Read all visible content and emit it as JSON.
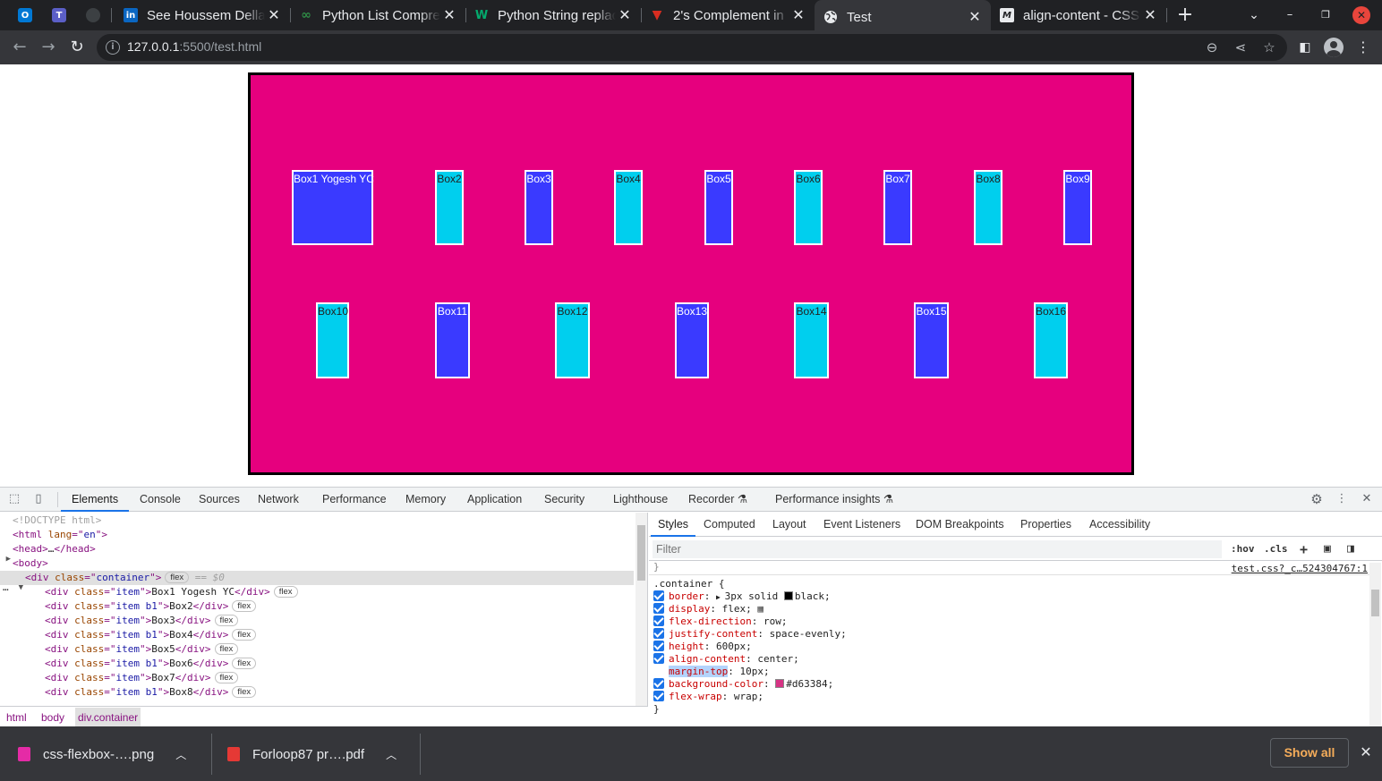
{
  "browser": {
    "pinned_tabs": [
      {
        "icon": "outlook-icon",
        "label": "O",
        "color": "#0078d4"
      },
      {
        "icon": "teams-icon",
        "label": "T",
        "color": "#5b5fc7"
      },
      {
        "icon": "github-icon",
        "label": "",
        "color": "#3c4043"
      }
    ],
    "tabs": [
      {
        "title": "See Houssem Dellai",
        "icon": "linkedin-icon",
        "icon_text": "in",
        "icon_color": "#0a66c2"
      },
      {
        "title": "Python List Comprehension",
        "icon": "geeksforgeeks-icon",
        "icon_text": "∞",
        "icon_color": "#2f8d46"
      },
      {
        "title": "Python String replace",
        "icon": "w3schools-icon",
        "icon_text": "W",
        "icon_color": "#04aa6d"
      },
      {
        "title": "2's Complement in",
        "icon": "tutorialspoint-icon",
        "icon_text": "▼",
        "icon_color": "#d92d20"
      },
      {
        "title": "Test",
        "icon": "globe-icon",
        "icon_text": "🌐",
        "icon_color": "#e8eaed",
        "active": true
      },
      {
        "title": "align-content - CSS",
        "icon": "mdn-icon",
        "icon_text": "M",
        "icon_color": "#e8eaed"
      }
    ],
    "url_host": "127.0.0.1",
    "url_path": ":5500/test.html"
  },
  "page": {
    "container_color": "#e6007e",
    "box_colors": {
      "blue": "#3a3aff",
      "cyan": "#00cfee"
    },
    "boxes": [
      {
        "label": "Box1 Yogesh YC",
        "color": "blue"
      },
      {
        "label": "Box2",
        "color": "cyan"
      },
      {
        "label": "Box3",
        "color": "blue"
      },
      {
        "label": "Box4",
        "color": "cyan"
      },
      {
        "label": "Box5",
        "color": "blue"
      },
      {
        "label": "Box6",
        "color": "cyan"
      },
      {
        "label": "Box7",
        "color": "blue"
      },
      {
        "label": "Box8",
        "color": "cyan"
      },
      {
        "label": "Box9",
        "color": "blue"
      },
      {
        "label": "Box10",
        "color": "cyan"
      },
      {
        "label": "Box11",
        "color": "blue"
      },
      {
        "label": "Box12",
        "color": "cyan"
      },
      {
        "label": "Box13",
        "color": "blue"
      },
      {
        "label": "Box14",
        "color": "cyan"
      },
      {
        "label": "Box15",
        "color": "blue"
      },
      {
        "label": "Box16",
        "color": "cyan"
      }
    ]
  },
  "devtools": {
    "tabs": [
      "Elements",
      "Console",
      "Sources",
      "Network",
      "Performance",
      "Memory",
      "Application",
      "Security",
      "Lighthouse",
      "Recorder ⚗",
      "Performance insights ⚗"
    ],
    "active_tab": "Elements",
    "dom_lines": [
      {
        "indent": 1,
        "arrow": "",
        "parts": [
          {
            "t": "<!DOCTYPE html>",
            "c": "grey"
          }
        ]
      },
      {
        "indent": 1,
        "arrow": "",
        "parts": [
          {
            "t": "<html ",
            "c": "tag"
          },
          {
            "t": "lang",
            "c": "attr"
          },
          {
            "t": "=\"",
            "c": "tag"
          },
          {
            "t": "en",
            "c": "val"
          },
          {
            "t": "\">",
            "c": "tag"
          }
        ]
      },
      {
        "indent": 1,
        "arrow": "▶",
        "parts": [
          {
            "t": "<head>",
            "c": "tag"
          },
          {
            "t": "…",
            "c": "txt"
          },
          {
            "t": "</head>",
            "c": "tag"
          }
        ]
      },
      {
        "indent": 1,
        "arrow": "▼",
        "parts": [
          {
            "t": "<body>",
            "c": "tag"
          }
        ]
      },
      {
        "indent": 2,
        "arrow": "▼",
        "sel": true,
        "pill": "flex",
        "suffix": " == $0",
        "parts": [
          {
            "t": "<div ",
            "c": "tag"
          },
          {
            "t": "class",
            "c": "attr"
          },
          {
            "t": "=\"",
            "c": "tag"
          },
          {
            "t": "container",
            "c": "val"
          },
          {
            "t": "\">",
            "c": "tag"
          }
        ]
      },
      {
        "indent": 3,
        "arrow": "",
        "pill": "flex",
        "parts": [
          {
            "t": "<div ",
            "c": "tag"
          },
          {
            "t": "class",
            "c": "attr"
          },
          {
            "t": "=\"",
            "c": "tag"
          },
          {
            "t": "item",
            "c": "val"
          },
          {
            "t": "\">",
            "c": "tag"
          },
          {
            "t": "Box1 Yogesh YC",
            "c": "txt"
          },
          {
            "t": "</div>",
            "c": "tag"
          }
        ]
      },
      {
        "indent": 3,
        "arrow": "",
        "pill": "flex",
        "parts": [
          {
            "t": "<div ",
            "c": "tag"
          },
          {
            "t": "class",
            "c": "attr"
          },
          {
            "t": "=\"",
            "c": "tag"
          },
          {
            "t": "item b1",
            "c": "val"
          },
          {
            "t": "\">",
            "c": "tag"
          },
          {
            "t": "Box2",
            "c": "txt"
          },
          {
            "t": "</div>",
            "c": "tag"
          }
        ]
      },
      {
        "indent": 3,
        "arrow": "",
        "pill": "flex",
        "parts": [
          {
            "t": "<div ",
            "c": "tag"
          },
          {
            "t": "class",
            "c": "attr"
          },
          {
            "t": "=\"",
            "c": "tag"
          },
          {
            "t": "item",
            "c": "val"
          },
          {
            "t": "\">",
            "c": "tag"
          },
          {
            "t": "Box3",
            "c": "txt"
          },
          {
            "t": "</div>",
            "c": "tag"
          }
        ]
      },
      {
        "indent": 3,
        "arrow": "",
        "pill": "flex",
        "parts": [
          {
            "t": "<div ",
            "c": "tag"
          },
          {
            "t": "class",
            "c": "attr"
          },
          {
            "t": "=\"",
            "c": "tag"
          },
          {
            "t": "item b1",
            "c": "val"
          },
          {
            "t": "\">",
            "c": "tag"
          },
          {
            "t": "Box4",
            "c": "txt"
          },
          {
            "t": "</div>",
            "c": "tag"
          }
        ]
      },
      {
        "indent": 3,
        "arrow": "",
        "pill": "flex",
        "parts": [
          {
            "t": "<div ",
            "c": "tag"
          },
          {
            "t": "class",
            "c": "attr"
          },
          {
            "t": "=\"",
            "c": "tag"
          },
          {
            "t": "item",
            "c": "val"
          },
          {
            "t": "\">",
            "c": "tag"
          },
          {
            "t": "Box5",
            "c": "txt"
          },
          {
            "t": "</div>",
            "c": "tag"
          }
        ]
      },
      {
        "indent": 3,
        "arrow": "",
        "pill": "flex",
        "parts": [
          {
            "t": "<div ",
            "c": "tag"
          },
          {
            "t": "class",
            "c": "attr"
          },
          {
            "t": "=\"",
            "c": "tag"
          },
          {
            "t": "item b1",
            "c": "val"
          },
          {
            "t": "\">",
            "c": "tag"
          },
          {
            "t": "Box6",
            "c": "txt"
          },
          {
            "t": "</div>",
            "c": "tag"
          }
        ]
      },
      {
        "indent": 3,
        "arrow": "",
        "pill": "flex",
        "parts": [
          {
            "t": "<div ",
            "c": "tag"
          },
          {
            "t": "class",
            "c": "attr"
          },
          {
            "t": "=\"",
            "c": "tag"
          },
          {
            "t": "item",
            "c": "val"
          },
          {
            "t": "\">",
            "c": "tag"
          },
          {
            "t": "Box7",
            "c": "txt"
          },
          {
            "t": "</div>",
            "c": "tag"
          }
        ]
      },
      {
        "indent": 3,
        "arrow": "",
        "pill": "flex",
        "parts": [
          {
            "t": "<div ",
            "c": "tag"
          },
          {
            "t": "class",
            "c": "attr"
          },
          {
            "t": "=\"",
            "c": "tag"
          },
          {
            "t": "item b1",
            "c": "val"
          },
          {
            "t": "\">",
            "c": "tag"
          },
          {
            "t": "Box8",
            "c": "txt"
          },
          {
            "t": "</div>",
            "c": "tag"
          }
        ]
      }
    ],
    "breadcrumbs": [
      "html",
      "body",
      "div.container"
    ],
    "styles_tabs": [
      "Styles",
      "Computed",
      "Layout",
      "Event Listeners",
      "DOM Breakpoints",
      "Properties",
      "Accessibility"
    ],
    "filter_placeholder": "Filter",
    "filter_buttons": [
      ":hov",
      ".cls",
      "+"
    ],
    "rule_selector": ".container {",
    "rule_source": "test.css?_c…524304767:1",
    "declarations": [
      {
        "checked": true,
        "prop": "border",
        "arrow": true,
        "value": "3px solid ",
        "swatch": "#000000",
        "value2": "black;"
      },
      {
        "checked": true,
        "prop": "display",
        "value": "flex;",
        "flex_icon": true
      },
      {
        "checked": true,
        "prop": "flex-direction",
        "value": "row;"
      },
      {
        "checked": true,
        "prop": "justify-content",
        "value": "space-evenly;"
      },
      {
        "checked": true,
        "prop": "height",
        "value": "600px;"
      },
      {
        "checked": true,
        "prop": "align-content",
        "value": "center;"
      },
      {
        "checked": false,
        "prop": "margin-top",
        "value": "10px;",
        "highlight": true
      },
      {
        "checked": true,
        "prop": "background-color",
        "value": "",
        "swatch": "#d63384",
        "value2": "#d63384;"
      },
      {
        "checked": true,
        "prop": "flex-wrap",
        "value": "wrap;"
      }
    ]
  },
  "downloads": {
    "items": [
      {
        "name": "css-flexbox-….png",
        "icon": "image-file-icon",
        "color": "#e52ba6"
      },
      {
        "name": "Forloop87 pr….pdf",
        "icon": "pdf-file-icon",
        "color": "#e53935"
      }
    ],
    "show_all": "Show all"
  }
}
